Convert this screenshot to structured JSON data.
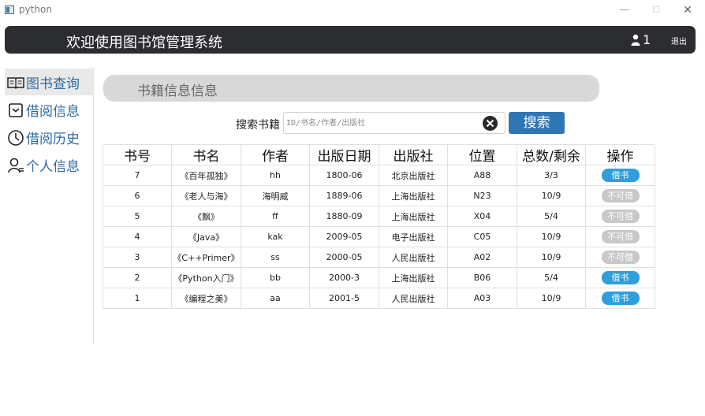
{
  "window": {
    "title": "python",
    "minimize_glyph": "—",
    "maximize_glyph": "☐",
    "close_glyph": "✕"
  },
  "header": {
    "title": "欢迎使用图书馆管理系统",
    "user_count": "1",
    "logout_label": "退出"
  },
  "sidebar": {
    "items": [
      {
        "label": "图书查询",
        "icon": "open-book-icon",
        "active": true
      },
      {
        "label": "借阅信息",
        "icon": "inbox-icon",
        "active": false
      },
      {
        "label": "借阅历史",
        "icon": "clock-icon",
        "active": false
      },
      {
        "label": "个人信息",
        "icon": "person-icon",
        "active": false
      }
    ]
  },
  "main": {
    "section_title": "书籍信息信息",
    "search": {
      "label": "搜索书籍",
      "placeholder": "ID/书名/作者/出版社",
      "value": "",
      "button_label": "搜索"
    },
    "table": {
      "columns": [
        "书号",
        "书名",
        "作者",
        "出版日期",
        "出版社",
        "位置",
        "总数/剩余",
        "操作"
      ],
      "rows": [
        {
          "id": "7",
          "title": "《百年孤独》",
          "author": "hh",
          "date": "1800-06",
          "publisher": "北京出版社",
          "location": "A88",
          "count": "3/3",
          "action": "借书",
          "available": true
        },
        {
          "id": "6",
          "title": "《老人与海》",
          "author": "海明威",
          "date": "1889-06",
          "publisher": "上海出版社",
          "location": "N23",
          "count": "10/9",
          "action": "不可借",
          "available": false
        },
        {
          "id": "5",
          "title": "《飘》",
          "author": "ff",
          "date": "1880-09",
          "publisher": "上海出版社",
          "location": "X04",
          "count": "5/4",
          "action": "不可借",
          "available": false
        },
        {
          "id": "4",
          "title": "《Java》",
          "author": "kak",
          "date": "2009-05",
          "publisher": "电子出版社",
          "location": "C05",
          "count": "10/9",
          "action": "不可借",
          "available": false
        },
        {
          "id": "3",
          "title": "《C++Primer》",
          "author": "ss",
          "date": "2000-05",
          "publisher": "人民出版社",
          "location": "A02",
          "count": "10/9",
          "action": "不可借",
          "available": false
        },
        {
          "id": "2",
          "title": "《Python入门》",
          "author": "bb",
          "date": "2000-3",
          "publisher": "上海出版社",
          "location": "B06",
          "count": "5/4",
          "action": "借书",
          "available": true
        },
        {
          "id": "1",
          "title": "《编程之美》",
          "author": "aa",
          "date": "2001-5",
          "publisher": "人民出版社",
          "location": "A03",
          "count": "10/9",
          "action": "借书",
          "available": true
        }
      ]
    }
  },
  "colors": {
    "header_bg": "#2c2d30",
    "accent_blue": "#2f76b5",
    "borrow_btn": "#2f9fdc",
    "disabled_btn": "#c8c8c8",
    "sidebar_text": "#2e6aa0"
  }
}
